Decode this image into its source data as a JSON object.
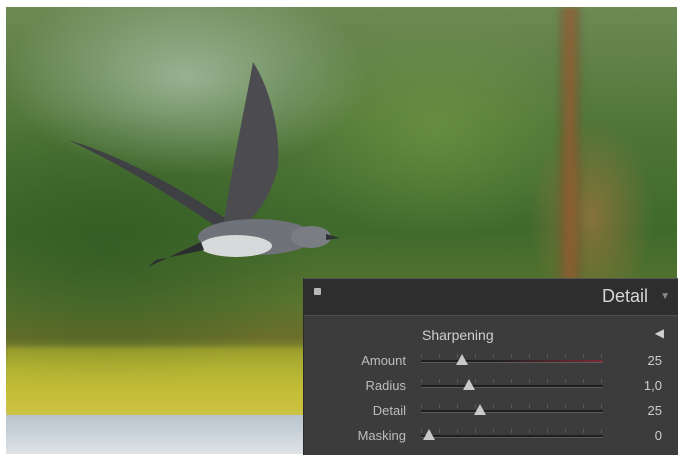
{
  "panel": {
    "title": "Detail",
    "header_icon": "collapse-icon",
    "menu_icon": "triangle-down-icon",
    "section": {
      "title": "Sharpening",
      "arrow_icon": "triangle-left-icon"
    },
    "sliders": [
      {
        "label": "Amount",
        "value": "25",
        "level": 0.18
      },
      {
        "label": "Radius",
        "value": "1,0",
        "level": 0.22
      },
      {
        "label": "Detail",
        "value": "25",
        "level": 0.28
      },
      {
        "label": "Masking",
        "value": "0",
        "level": 0.0
      }
    ]
  },
  "colors": {
    "panel_bg": "#3c3c3c",
    "header_bg": "#2e2e2e",
    "text": "#c8c8c8",
    "accent_track": "#7a2a35"
  }
}
